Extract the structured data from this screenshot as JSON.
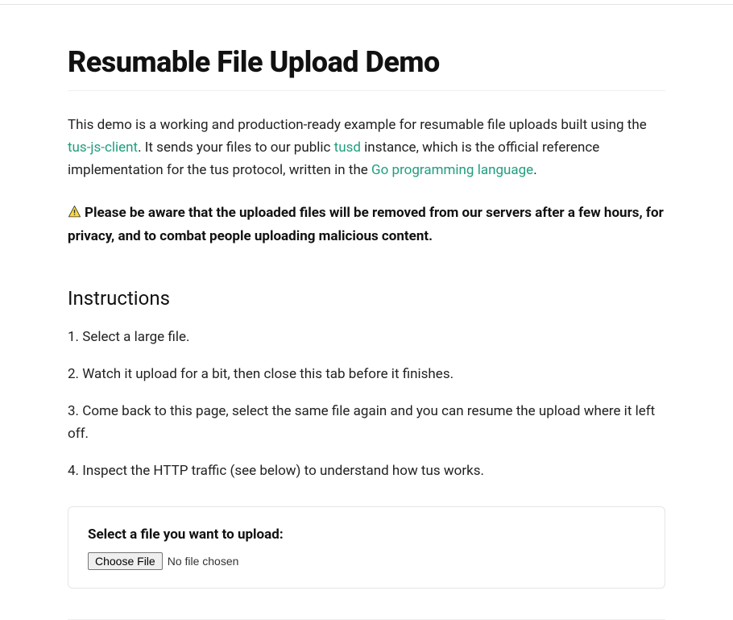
{
  "title": "Resumable File Upload Demo",
  "intro": {
    "part1": "This demo is a working and production-ready example for resumable file uploads built using the ",
    "link1": "tus-js-client",
    "part2": ". It sends your files to our public ",
    "link2": "tusd",
    "part3": " instance, which is the official reference implementation for the tus protocol, written in the ",
    "link3": "Go programming language",
    "part4": "."
  },
  "warning": "Please be aware that the uploaded files will be removed from our servers after a few hours, for privacy, and to combat people uploading malicious content.",
  "instructionsHeading": "Instructions",
  "steps": [
    "1. Select a large file.",
    "2. Watch it upload for a bit, then close this tab before it finishes.",
    "3. Come back to this page, select the same file again and you can resume the upload where it left off.",
    "4. Inspect the HTTP traffic (see below) to understand how tus works."
  ],
  "upload": {
    "label": "Select a file you want to upload:",
    "button": "Choose File",
    "status": "No file chosen"
  }
}
